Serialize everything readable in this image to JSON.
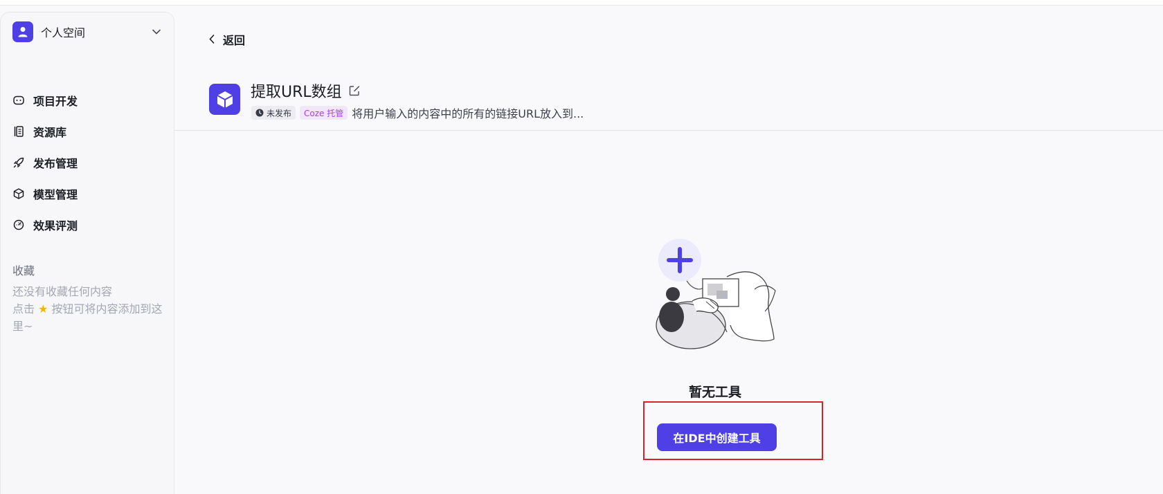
{
  "workspace": {
    "name": "个人空间",
    "icon": "user-icon"
  },
  "nav": [
    {
      "label": "项目开发",
      "icon": "gamepad-icon"
    },
    {
      "label": "资源库",
      "icon": "library-icon"
    },
    {
      "label": "发布管理",
      "icon": "rocket-icon"
    },
    {
      "label": "模型管理",
      "icon": "cube-outline-icon"
    },
    {
      "label": "效果评测",
      "icon": "gauge-icon"
    }
  ],
  "favorites": {
    "title": "收藏",
    "empty_line1": "还没有收藏任何内容",
    "empty_line2_prefix": "点击",
    "empty_line2_suffix": "按钮可将内容添加到这里~"
  },
  "header": {
    "back_label": "返回",
    "title": "提取URL数组",
    "status_badge": "未发布",
    "host_badge": "Coze 托管",
    "description": "将用户输入的内容中的所有的链接URL放入到..."
  },
  "empty_state": {
    "title": "暂无工具",
    "button_label": "在IDE中创建工具"
  },
  "colors": {
    "brand": "#4e40e5",
    "highlight": "#d6232b",
    "host_badge_text": "#a73fe0",
    "host_badge_bg": "#f2e6fb"
  }
}
